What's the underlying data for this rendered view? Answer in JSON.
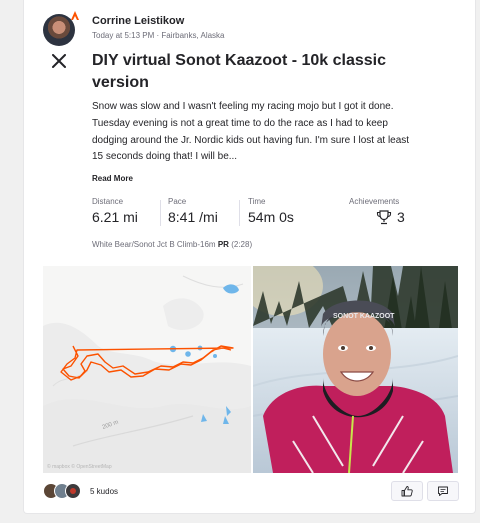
{
  "athlete": {
    "name": "Corrine Leistikow",
    "meta": "Today at 5:13 PM · Fairbanks, Alaska"
  },
  "activity": {
    "title": "DIY virtual Sonot Kaazoot - 10k classic version",
    "description": "Snow was slow and I wasn't feeling my racing mojo but I got it done. Tuesday evening is not a great time to do the race as I had to keep dodging around the Jr. Nordic kids out having fun. I'm sure I lost at least 15 seconds doing that! I will be...",
    "read_more": "Read More"
  },
  "stats": {
    "distance": {
      "label": "Distance",
      "value": "6.21 mi"
    },
    "pace": {
      "label": "Pace",
      "value": "8:41 /mi"
    },
    "time": {
      "label": "Time",
      "value": "54m 0s"
    },
    "achievements": {
      "label": "Achievements",
      "value": "3"
    }
  },
  "segment": {
    "text": "White Bear/Sonot Jct B Climb-16m",
    "badge": "PR",
    "time": "(2:28)"
  },
  "map": {
    "scale_label": "200 m",
    "route_color": "#fc5200",
    "attribution": "© mapbox © OpenStreetMap"
  },
  "photo": {
    "headband_text": "SONOT KAAZOOT"
  },
  "social": {
    "kudos": "5 kudos"
  },
  "icons": {
    "brand_badge": "strava-badge-icon",
    "social": "x-icon",
    "achievements": "trophy-icon",
    "kudos": "thumbs-up-icon",
    "comment": "comment-icon"
  }
}
